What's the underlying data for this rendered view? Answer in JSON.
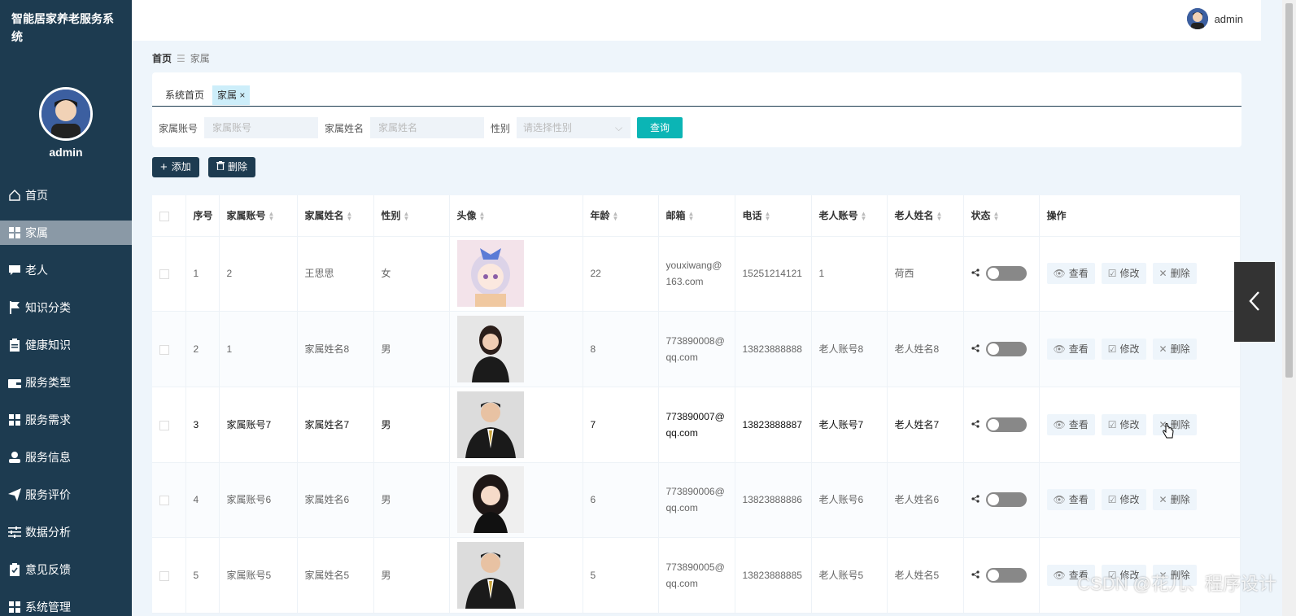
{
  "app": {
    "title": "智能居家养老服务系统",
    "user": "admin"
  },
  "sidebar": {
    "admin_name": "admin",
    "items": [
      {
        "label": "首页",
        "icon": "home-icon"
      },
      {
        "label": "家属",
        "icon": "grid-icon",
        "active": true
      },
      {
        "label": "老人",
        "icon": "chat-icon"
      },
      {
        "label": "知识分类",
        "icon": "flag-icon"
      },
      {
        "label": "健康知识",
        "icon": "clipboard-icon"
      },
      {
        "label": "服务类型",
        "icon": "wallet-icon"
      },
      {
        "label": "服务需求",
        "icon": "grid-icon"
      },
      {
        "label": "服务信息",
        "icon": "user-icon"
      },
      {
        "label": "服务评价",
        "icon": "send-icon"
      },
      {
        "label": "数据分析",
        "icon": "sliders-icon"
      },
      {
        "label": "意见反馈",
        "icon": "check-clipboard-icon"
      },
      {
        "label": "系统管理",
        "icon": "grid-icon"
      }
    ]
  },
  "breadcrumb": {
    "home": "首页",
    "current": "家属"
  },
  "tabs": [
    {
      "label": "系统首页"
    },
    {
      "label": "家属",
      "active": true
    }
  ],
  "search": {
    "account_label": "家属账号",
    "account_placeholder": "家属账号",
    "name_label": "家属姓名",
    "name_placeholder": "家属姓名",
    "gender_label": "性别",
    "gender_placeholder": "请选择性别",
    "query_label": "查询"
  },
  "toolbar": {
    "add_label": "添加",
    "delete_label": "删除"
  },
  "table": {
    "headers": [
      "序号",
      "家属账号",
      "家属姓名",
      "性别",
      "头像",
      "年龄",
      "邮箱",
      "电话",
      "老人账号",
      "老人姓名",
      "状态",
      "操作"
    ],
    "actions": {
      "view": "查看",
      "edit": "修改",
      "delete": "删除"
    },
    "rows": [
      {
        "no": "1",
        "account": "2",
        "name": "王思思",
        "gender": "女",
        "avatar": "anime-girl",
        "age": "22",
        "email1": "youxiwang@",
        "email2": "163.com",
        "phone": "15251214121",
        "elder_account": "1",
        "elder_name": "荷西"
      },
      {
        "no": "2",
        "account": "1",
        "name": "家属姓名8",
        "gender": "男",
        "avatar": "woman-suit",
        "age": "8",
        "email1": "773890008@",
        "email2": "qq.com",
        "phone": "13823888888",
        "elder_account": "老人账号8",
        "elder_name": "老人姓名8"
      },
      {
        "no": "3",
        "account": "家属账号7",
        "name": "家属姓名7",
        "gender": "男",
        "avatar": "man-suit",
        "age": "7",
        "email1": "773890007@",
        "email2": "qq.com",
        "phone": "13823888887",
        "elder_account": "老人账号7",
        "elder_name": "老人姓名7",
        "highlight": true
      },
      {
        "no": "4",
        "account": "家属账号6",
        "name": "家属姓名6",
        "gender": "男",
        "avatar": "girl-curly",
        "age": "6",
        "email1": "773890006@",
        "email2": "qq.com",
        "phone": "13823888886",
        "elder_account": "老人账号6",
        "elder_name": "老人姓名6"
      },
      {
        "no": "5",
        "account": "家属账号5",
        "name": "家属姓名5",
        "gender": "男",
        "avatar": "man-suit",
        "age": "5",
        "email1": "773890005@",
        "email2": "qq.com",
        "phone": "13823888885",
        "elder_account": "老人账号5",
        "elder_name": "老人姓名5"
      }
    ]
  },
  "watermark": "CSDN @花儿、程序设计"
}
